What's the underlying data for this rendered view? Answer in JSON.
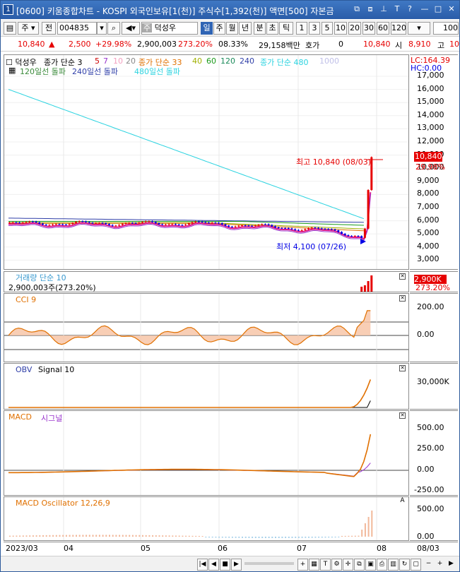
{
  "window": {
    "number": "1",
    "title": "[0600] 키움종합차트 - KOSPI 외국인보유[1(천)] 주식수[1,392(천)] 액면[500] 자본금"
  },
  "toolbar": {
    "type_select": "주",
    "period_btn": "전",
    "code_value": "004835",
    "stock_name": "덕성우",
    "stock_prefix": "주",
    "periods": [
      "일",
      "주",
      "월",
      "년",
      "분",
      "초",
      "틱"
    ],
    "active_period": "일",
    "intervals": [
      "1",
      "3",
      "5",
      "10",
      "20",
      "30",
      "60",
      "120"
    ],
    "count_value": "100"
  },
  "quote": {
    "price": "10,840",
    "change": "2,500",
    "change_pct": "+29.98%",
    "volume": "2,900,003",
    "volume_ratio": "273.20%",
    "turnover": "08.33%",
    "amount": "29,158백만",
    "hoga_label": "호가",
    "hoga_value": "0",
    "ask": "10,840",
    "open_label": "시",
    "open": "8,910",
    "high_label": "고",
    "high": "10"
  },
  "price_pane": {
    "stock": "덕성우",
    "ma_label_1": "종가 단순 3",
    "ma_3": "3",
    "ma_5": "5",
    "ma_7": "7",
    "ma_10": "10",
    "ma_20": "20",
    "ma_label_2": "종가 단순 33",
    "ma_40": "40",
    "ma_60": "60",
    "ma_120": "120",
    "ma_240": "240",
    "ma_label_3": "종가 단순 480",
    "ma_1000": "1000",
    "break_120": "120일선 돌파",
    "break_240": "240일선 돌파",
    "break_480": "480일선 돌파",
    "lc": "LC:164.39",
    "hc": "HC:0.00",
    "max_label": "최고 10,840 (08/03)",
    "min_label": "최저 4,100 (07/26)",
    "last_price": "10,840",
    "last_pct": "29.98%",
    "y_ticks": [
      "17,000",
      "16,000",
      "15,000",
      "14,000",
      "13,000",
      "12,000",
      "11,000",
      "10,000",
      "9,000",
      "8,000",
      "7,000",
      "6,000",
      "5,000",
      "4,000",
      "3,000"
    ]
  },
  "volume_pane": {
    "title": "거래량 단순 10",
    "value": "2,900,003주(273.20%)",
    "last": "2,900K",
    "last_pct": "273.20%"
  },
  "cci_pane": {
    "title": "CCI 9",
    "ticks": [
      "200.00",
      "0.00"
    ]
  },
  "obv_pane": {
    "title": "OBV",
    "signal": "Signal 10",
    "ticks": [
      "30,000K"
    ]
  },
  "macd_pane": {
    "title": "MACD",
    "signal": "시그널",
    "ticks": [
      "500.00",
      "250.00",
      "0.00",
      "-250.00"
    ]
  },
  "osc_pane": {
    "title": "MACD Oscillator 12,26,9",
    "ticks": [
      "500.00",
      "0.00"
    ]
  },
  "x_axis": {
    "labels": [
      "2023/03",
      "04",
      "05",
      "06",
      "07",
      "08",
      "08/03"
    ]
  },
  "colors": {
    "title_bg": "#2a5ca8",
    "up": "#e60000",
    "down": "#0000e6",
    "ma_cyan": "#2bd3e0",
    "ma_navy": "#2f3fa8"
  }
}
